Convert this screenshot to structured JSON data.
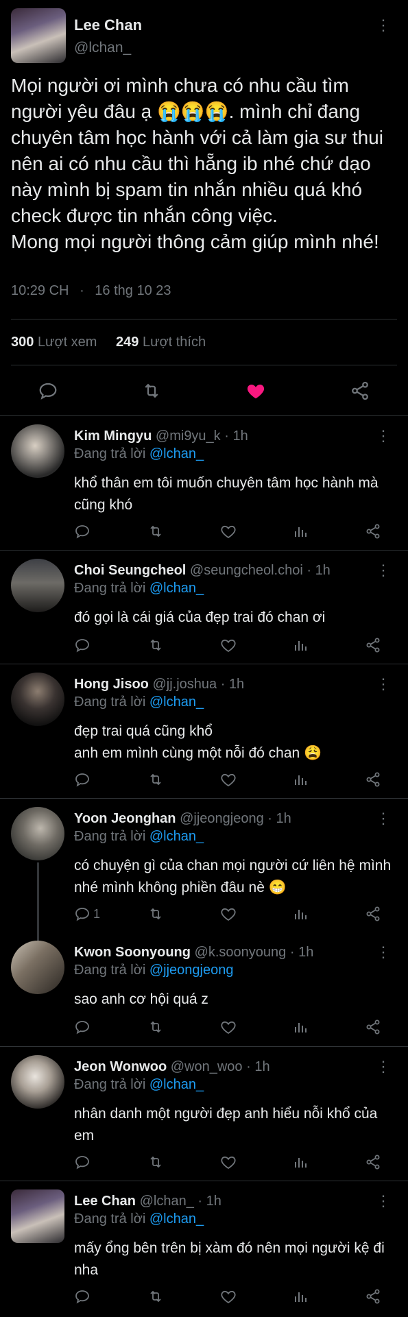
{
  "tweet": {
    "name": "Lee Chan",
    "handle": "@lchan_",
    "text": "Mọi người ơi mình chưa có nhu cầu tìm người yêu đâu ạ 😭😭😭. mình chỉ đang chuyên tâm học hành với cả làm gia sư thui nên ai có nhu cầu thì hẵng ib nhé chứ dạo này mình bị spam tin nhắn nhiều quá khó check được tin nhắn công việc.\nMong mọi người thông cảm giúp mình nhé!",
    "time": "10:29 CH",
    "date": "16 thg 10 23",
    "views_count": "300",
    "views_label": "Lượt xem",
    "likes_count": "249",
    "likes_label": "Lượt thích",
    "liked": true,
    "like_color": "#f91880"
  },
  "reply_prefix": "Đang trả lời",
  "replies": [
    {
      "name": "Kim Mingyu",
      "handle": "@mi9yu_k",
      "time": "1h",
      "to": "@lchan_",
      "text": "khổ thân em tôi muốn chuyên tâm học hành mà cũng khó",
      "reply_count": ""
    },
    {
      "name": "Choi Seungcheol",
      "handle": "@seungcheol.choi",
      "time": "1h",
      "to": "@lchan_",
      "text": "đó gọi là cái giá của đẹp trai đó chan ơi",
      "reply_count": ""
    },
    {
      "name": "Hong Jisoo",
      "handle": "@jj.joshua",
      "time": "1h",
      "to": "@lchan_",
      "text": "đẹp trai quá cũng khổ\nanh em mình cùng một nỗi đó chan 😩",
      "reply_count": ""
    },
    {
      "name": "Yoon Jeonghan",
      "handle": "@jjeongjeong",
      "time": "1h",
      "to": "@lchan_",
      "text": "có chuyện gì của chan mọi người cứ liên hệ mình nhé mình không phiền đâu nè 😁",
      "reply_count": "1"
    },
    {
      "name": "Kwon Soonyoung",
      "handle": "@k.soonyoung",
      "time": "1h",
      "to": "@jjeongjeong",
      "text": "sao anh cơ hội quá z",
      "reply_count": ""
    },
    {
      "name": "Jeon Wonwoo",
      "handle": "@won_woo",
      "time": "1h",
      "to": "@lchan_",
      "text": "nhân danh một người đẹp anh hiểu nỗi khổ của em",
      "reply_count": ""
    },
    {
      "name": "Lee Chan",
      "handle": "@lchan_",
      "time": "1h",
      "to": "@lchan_",
      "text": "mấy ổng bên trên bị xàm đó nên mọi người kệ đi nha",
      "reply_count": ""
    }
  ],
  "icons": [
    "more-icon",
    "reply-icon",
    "retweet-icon",
    "heart-icon",
    "share-icon",
    "views-icon"
  ],
  "colors": {
    "background": "#000000",
    "text": "#e7e9ea",
    "muted": "#71767b",
    "link": "#1d9bf0",
    "like": "#f91880"
  }
}
